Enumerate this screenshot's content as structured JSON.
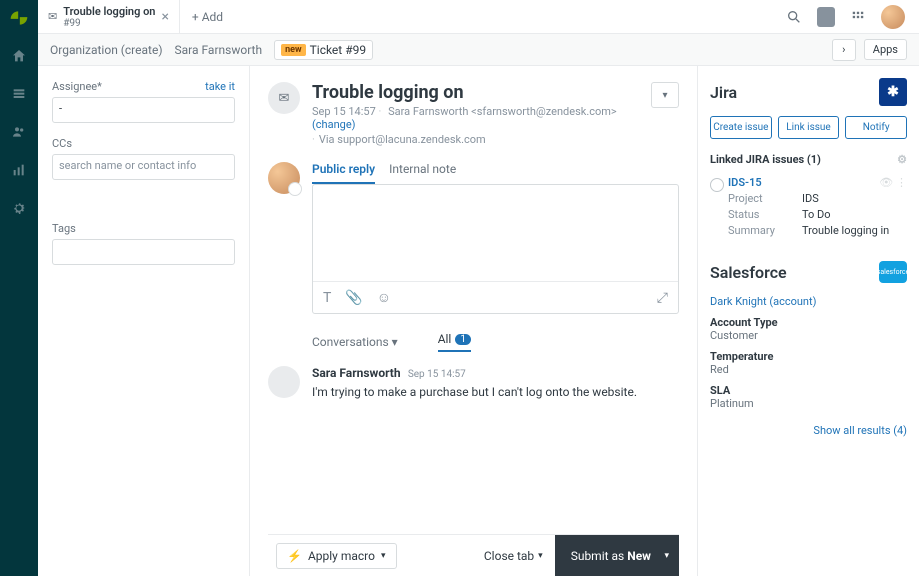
{
  "header": {
    "tab_title": "Trouble logging on",
    "tab_sub": "#99",
    "add_label": "+ Add"
  },
  "crumbs": {
    "org": "Organization (create)",
    "name": "Sara Farnsworth",
    "new_chip": "new",
    "ticket": "Ticket #99",
    "apps_btn": "Apps"
  },
  "side": {
    "assignee_label": "Assignee*",
    "take_it": "take it",
    "assignee_value": "-",
    "ccs_label": "CCs",
    "ccs_placeholder": "search name or contact info",
    "tags_label": "Tags"
  },
  "ticket": {
    "title": "Trouble logging on",
    "date": "Sep 15 14:57",
    "requester": "Sara Farnsworth <sfarnsworth@zendesk.com>",
    "change": "(change)",
    "via": "Via support@lacuna.zendesk.com"
  },
  "composer": {
    "tab_public": "Public reply",
    "tab_internal": "Internal note"
  },
  "conv": {
    "label": "Conversations",
    "filter_all": "All",
    "filter_count": "1"
  },
  "msg": {
    "author": "Sara Farnsworth",
    "time": "Sep 15 14:57",
    "body": "I'm trying to make a purchase but I can't log onto the website."
  },
  "footer": {
    "macro": "Apply macro",
    "close_tab": "Close tab",
    "submit_pre": "Submit as ",
    "submit_status": "New"
  },
  "jira": {
    "heading": "Jira",
    "btn_create": "Create issue",
    "btn_link": "Link issue",
    "btn_notify": "Notify",
    "linked_label": "Linked JIRA issues (1)",
    "issue_key": "IDS-15",
    "project_k": "Project",
    "project_v": "IDS",
    "status_k": "Status",
    "status_v": "To Do",
    "summary_k": "Summary",
    "summary_v": "Trouble logging in"
  },
  "sf": {
    "heading": "Salesforce",
    "logo_text": "salesforce",
    "account_link": "Dark Knight (account)",
    "f1k": "Account Type",
    "f1v": "Customer",
    "f2k": "Temperature",
    "f2v": "Red",
    "f3k": "SLA",
    "f3v": "Platinum",
    "show_all": "Show all results (4)"
  }
}
